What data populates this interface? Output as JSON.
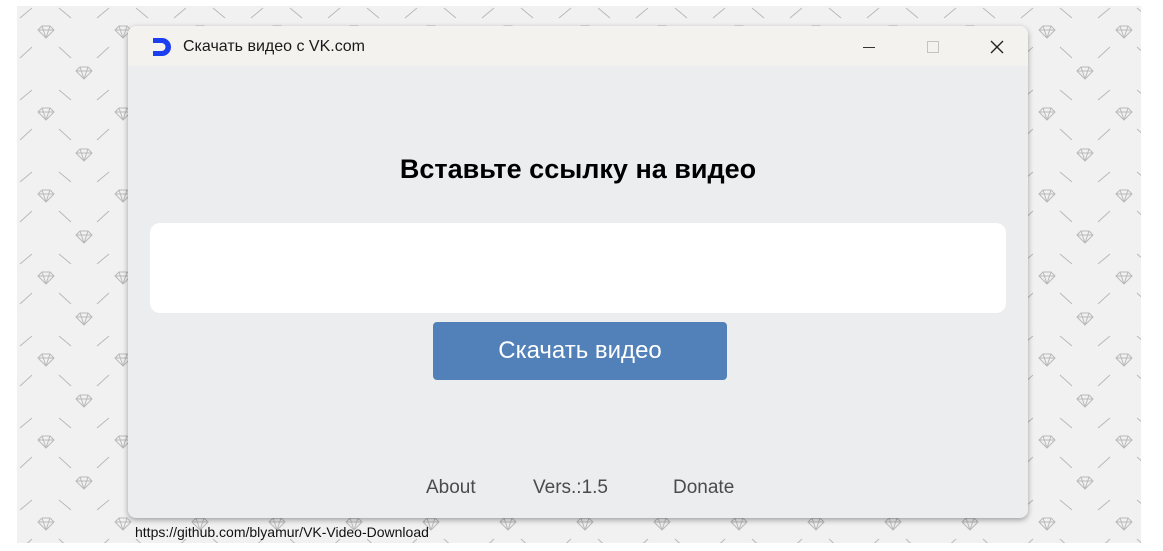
{
  "window": {
    "title": "Скачать видео с VK.com",
    "app_icon": "vk-download-icon",
    "controls": {
      "minimize": "minimize-icon",
      "maximize": "maximize-icon",
      "close": "close-icon"
    }
  },
  "main": {
    "heading": "Вставьте ссылку на видео",
    "url_input": {
      "value": "",
      "placeholder": ""
    },
    "download_button": "Скачать видео"
  },
  "footer": {
    "about": "About",
    "version": "Vers.:1.5",
    "donate": "Donate"
  },
  "status_bar": {
    "url": "https://github.com/blyamur/VK-Video-Download"
  },
  "colors": {
    "accent": "#5181b8",
    "app_icon": "#1a3ef0",
    "window_bg": "#ecedef",
    "titlebar_bg": "#f3f2ef",
    "backdrop": "#f1f1f1"
  }
}
